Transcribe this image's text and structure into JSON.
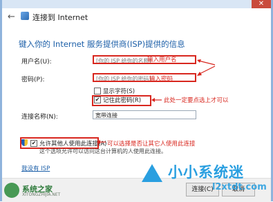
{
  "window": {
    "title": "连接到 Internet",
    "close_glyph": "✕"
  },
  "heading": "键入你的 Internet 服务提供商(ISP)提供的信息",
  "fields": {
    "username": {
      "label": "用户名(U):",
      "placeholder": "[你的 ISP 给你的名称]",
      "annotation": "输入用户名"
    },
    "password": {
      "label": "密码(P):",
      "placeholder": "[你的 ISP 给你的密码]",
      "annotation": "输入密码"
    },
    "connection_name": {
      "label": "连接名称(N):",
      "value": "宽带连接"
    }
  },
  "checkboxes": {
    "show_chars": {
      "label": "显示字符(S)",
      "checked": false
    },
    "remember_password": {
      "label": "记住此密码(R)",
      "checked": true,
      "annotation": "此处一定要点选上才可以"
    },
    "allow_others": {
      "label": "允许其他人使用此连接(A)",
      "checked": true,
      "annotation": "可以选择是否让其它人使用此连接",
      "note": "这个选项允许可以访问这台计算机的人使用此连接。"
    }
  },
  "link_no_isp": "我没有 ISP",
  "buttons": {
    "connect": "连接(C)",
    "cancel": "取消"
  },
  "watermarks": {
    "left": {
      "text": "系统之家",
      "sub": "XITONGZHIJIA.NET"
    },
    "right": {
      "text": "小小系统迷",
      "url": "l2xtdt.com"
    }
  },
  "colors": {
    "accent_blue": "#1c5fa8",
    "annotation_red": "#d8261e",
    "watermark_blue": "#2a9fe0"
  }
}
